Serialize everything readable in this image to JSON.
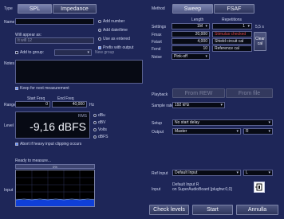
{
  "type": {
    "label": "Type",
    "spl": "SPL",
    "impedance": "Impedance"
  },
  "name": {
    "label": "Name",
    "value": ""
  },
  "will_appear_as": {
    "label": "Will appear as:",
    "value": "It will 12"
  },
  "options": {
    "add_number": "Add number",
    "add_date_time": "Add date/time",
    "use_as_entered": "Use as entered",
    "prefix_with_output": "Prefix with output"
  },
  "group": {
    "add_label": "Add to group:",
    "new_group": "New group"
  },
  "notes": {
    "label": "Notes",
    "keep_label": "Keep for next measurement"
  },
  "range": {
    "label": "Range",
    "start_label": "Start Freq",
    "end_label": "End Freq",
    "start": "0",
    "end": "40,000",
    "unit": "Hz"
  },
  "level": {
    "label": "Level",
    "rms_label": "RMS",
    "value": "-9,16 dBFS",
    "units": [
      "dBu",
      "dBV",
      "Volts",
      "dBFS"
    ],
    "selected_unit": "dBFS",
    "abort_label": "Abort if heavy input clipping occurs"
  },
  "ready": {
    "label": "Ready to measure...",
    "percent": "0%"
  },
  "input": {
    "label": "Input"
  },
  "method": {
    "label": "Method",
    "sweep": "Sweep",
    "fsaf": "FSAF"
  },
  "settings": {
    "label": "Settings",
    "length_label": "Length",
    "repetitions_label": "Repetitions",
    "length_value": "1M",
    "repetitions_value": "1",
    "duration": "5,5 s",
    "rows": [
      {
        "label": "Fmax",
        "value": "20,000",
        "text": "Stimulus checked",
        "text_red": true
      },
      {
        "label": "Fstart",
        "value": "4,000",
        "text": "Shield circuit cal",
        "text_red": false
      },
      {
        "label": "Fend",
        "value": "10",
        "text": "Reference cal",
        "text_red": false
      }
    ],
    "clear_cal": "Clear cal",
    "noise_label": "Noise",
    "noise_value": "Pink-off"
  },
  "playback": {
    "label": "Playback",
    "from_rew": "From REW",
    "from_file": "From file"
  },
  "sample_rate": {
    "label": "Sample rate",
    "value": "192 kHz"
  },
  "setup": {
    "label": "Setup",
    "value": "No start delay"
  },
  "output": {
    "label": "Output",
    "device": "Master",
    "channel": "R"
  },
  "ref_input": {
    "label": "Ref Input",
    "value": "Default Input",
    "channel": "L"
  },
  "input_right": {
    "label": "Input",
    "line1": "Default Input R",
    "line2": "on SuperAudioBoard [plughw:0,0]"
  },
  "actions": {
    "check_levels": "Check levels",
    "start": "Start",
    "cancel": "Annulla"
  },
  "colors": {
    "background": "#1e2658",
    "accent": "#5b8cff",
    "error": "#e04848"
  }
}
